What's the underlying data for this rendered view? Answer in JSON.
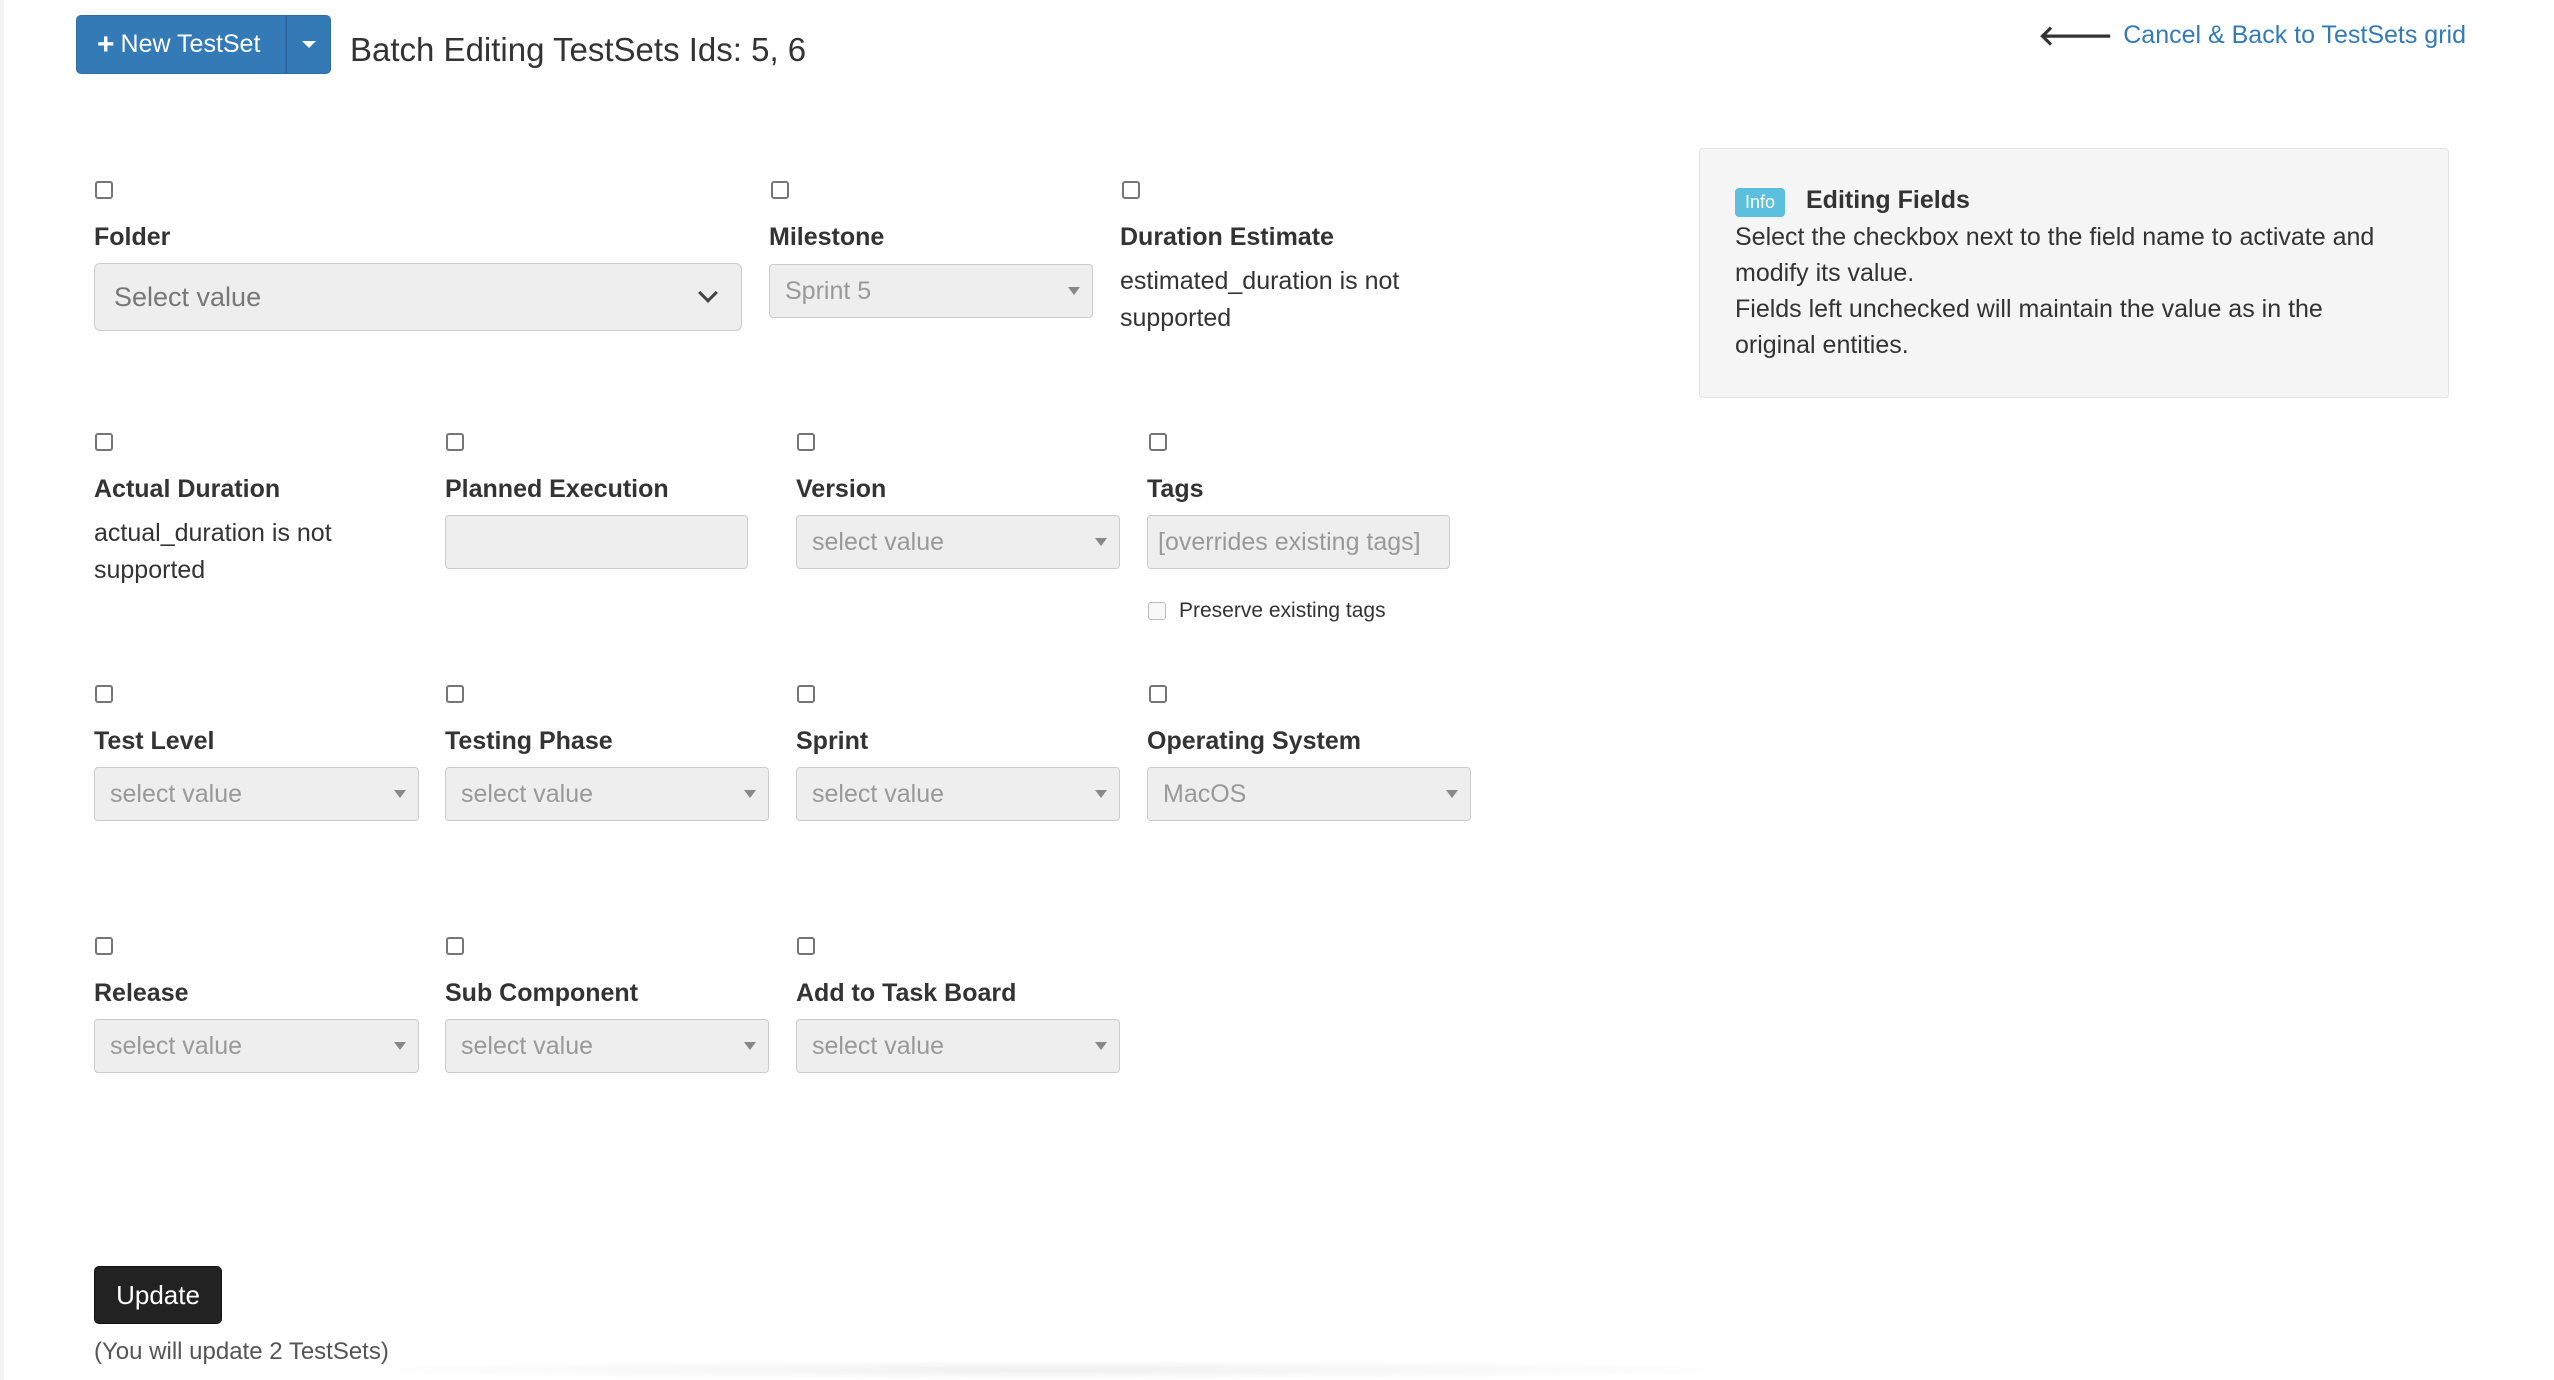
{
  "header": {
    "new_button_label": "New TestSet",
    "title": "Batch Editing TestSets Ids: 5, 6",
    "cancel_link": "Cancel & Back to TestSets grid"
  },
  "fields": {
    "folder": {
      "label": "Folder",
      "value": "Select value"
    },
    "milestone": {
      "label": "Milestone",
      "value": "Sprint 5"
    },
    "duration_estimate": {
      "label": "Duration Estimate",
      "note_line1": "estimated_duration is not",
      "note_line2": "supported"
    },
    "actual_duration": {
      "label": "Actual Duration",
      "note_line1": "actual_duration is not",
      "note_line2": "supported"
    },
    "planned_execution": {
      "label": "Planned Execution",
      "value": ""
    },
    "version": {
      "label": "Version",
      "value": "select value"
    },
    "tags": {
      "label": "Tags",
      "placeholder": "[overrides existing tags]",
      "preserve_label": "Preserve existing tags"
    },
    "test_level": {
      "label": "Test Level",
      "value": "select value"
    },
    "testing_phase": {
      "label": "Testing Phase",
      "value": "select value"
    },
    "sprint": {
      "label": "Sprint",
      "value": "select value"
    },
    "operating_system": {
      "label": "Operating System",
      "value": "MacOS"
    },
    "release": {
      "label": "Release",
      "value": "select value"
    },
    "sub_component": {
      "label": "Sub Component",
      "value": "select value"
    },
    "add_to_task_board": {
      "label": "Add to Task Board",
      "value": "select value"
    }
  },
  "info": {
    "badge": "Info",
    "title": "Editing Fields",
    "line1": "Select the checkbox next to the field name to activate and",
    "line2": "modify its value.",
    "line3": "Fields left unchecked will maintain the value as in the",
    "line4": "original entities."
  },
  "footer": {
    "update_label": "Update",
    "update_note": "(You will update 2 TestSets)"
  },
  "colors": {
    "primary": "#337ab7",
    "link": "#337ab7",
    "info_badge": "#5bc0de",
    "update_button": "#222222",
    "input_bg": "#eeeeee"
  }
}
